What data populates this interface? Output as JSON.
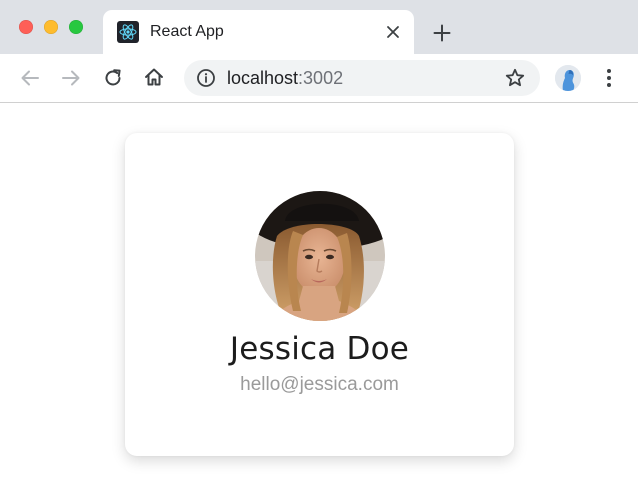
{
  "tab": {
    "title": "React App",
    "favicon": "react-logo-icon"
  },
  "toolbar": {
    "url_host": "localhost",
    "url_port": ":3002"
  },
  "profile_card": {
    "name": "Jessica Doe",
    "email": "hello@jessica.com"
  },
  "colors": {
    "tabstrip_bg": "#dee1e6",
    "close_red": "#fe5f57",
    "minimize_yellow": "#febc2e",
    "maximize_green": "#28c840",
    "react_cyan": "#61dafb",
    "email_gray": "#9a9a9a"
  }
}
